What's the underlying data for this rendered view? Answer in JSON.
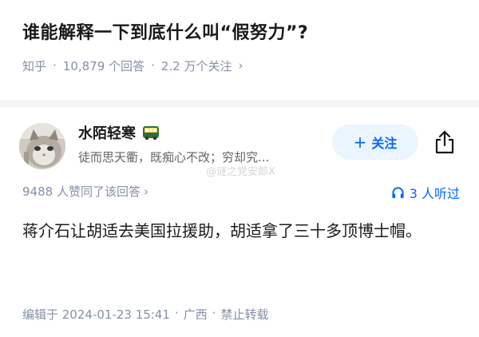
{
  "question": {
    "title": "谁能解释一下到底什么叫“假努力”?",
    "source": "知乎",
    "answers": "10,879 个回答",
    "followers": "2.2 万个关注",
    "separator": "·",
    "chevron": "›"
  },
  "author": {
    "name": "水陌轻寒",
    "signature": "徒而思天衢，既痴心不改；穷却究...",
    "follow_label": "关注",
    "follow_plus": "+",
    "avatar_icon": "cat-avatar",
    "badge_icon": "bus-badge-icon",
    "share_icon": "share-icon"
  },
  "watermark": "@谜之党安郎X",
  "stats": {
    "votes": "9488 人赞同了该回答",
    "chevron": "›",
    "listeners": "3 人听过",
    "listen_icon": "headphone-icon"
  },
  "content": {
    "text": "蒋介石让胡适去美国拉援助，胡适拿了三十多顶博士帽。"
  },
  "footer": {
    "edited": "编辑于 2024-01-23 15:41",
    "location": "广西",
    "rights": "禁止转载",
    "separator": "·"
  },
  "colors": {
    "accent": "#0066ff",
    "follow_bg": "#ebf5ff",
    "meta": "#8590a6",
    "divider": "#f4f4f6"
  }
}
